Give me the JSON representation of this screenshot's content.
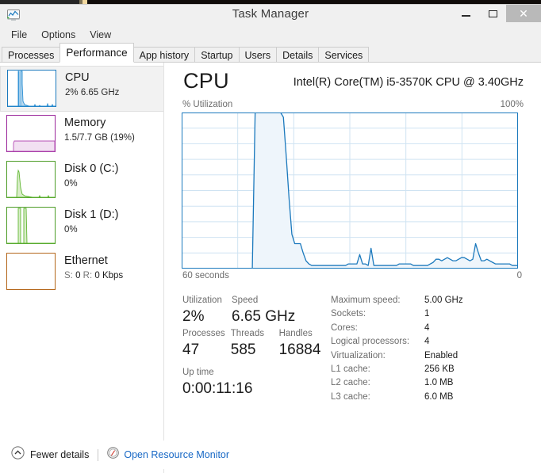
{
  "window": {
    "title": "Task Manager",
    "app_icon": "task-manager-icon",
    "controls": {
      "minimize": "–",
      "maximize": "☐",
      "close": "✕"
    }
  },
  "menubar": {
    "items": [
      {
        "label": "File"
      },
      {
        "label": "Options"
      },
      {
        "label": "View"
      }
    ]
  },
  "tabs": [
    {
      "label": "Processes",
      "active": false
    },
    {
      "label": "Performance",
      "active": true
    },
    {
      "label": "App history",
      "active": false
    },
    {
      "label": "Startup",
      "active": false
    },
    {
      "label": "Users",
      "active": false
    },
    {
      "label": "Details",
      "active": false
    },
    {
      "label": "Services",
      "active": false
    }
  ],
  "sidebar": {
    "items": [
      {
        "name": "CPU",
        "title": "CPU",
        "subtitle": "2%  6.65 GHz",
        "selected": true,
        "color": "#1b79bd",
        "fill": "#bcd9ee"
      },
      {
        "name": "Memory",
        "title": "Memory",
        "subtitle": "1.5/7.7 GB (19%)",
        "selected": false,
        "color": "#9b279b",
        "fill": "#f2e0f2"
      },
      {
        "name": "Disk 0 (C:)",
        "title": "Disk 0 (C:)",
        "subtitle": "0%",
        "selected": false,
        "color": "#4d9c27",
        "fill": "#d9edc9"
      },
      {
        "name": "Disk 1 (D:)",
        "title": "Disk 1 (D:)",
        "subtitle": "0%",
        "selected": false,
        "color": "#4d9c27",
        "fill": "#d9edc9"
      },
      {
        "name": "Ethernet",
        "title": "Ethernet",
        "subtitle_prefix_s": "S: ",
        "subtitle_val_s": "0",
        "subtitle_prefix_r": " R: ",
        "subtitle_val_r": "0 Kbps",
        "subtitle": "S: 0 R: 0 Kbps",
        "selected": false,
        "color": "#b4661a",
        "fill": "#f5e3d0"
      }
    ]
  },
  "main": {
    "heading": "CPU",
    "model": "Intel(R) Core(TM) i5-3570K CPU @ 3.40GHz",
    "axis": {
      "y_label": "% Utilization",
      "y_max": "100%",
      "x_left": "60 seconds",
      "x_right": "0"
    },
    "stats": {
      "utilization_label": "Utilization",
      "utilization_value": "2%",
      "speed_label": "Speed",
      "speed_value": "6.65 GHz",
      "processes_label": "Processes",
      "processes_value": "47",
      "threads_label": "Threads",
      "threads_value": "585",
      "handles_label": "Handles",
      "handles_value": "16884",
      "uptime_label": "Up time",
      "uptime_value": "0:00:11:16"
    },
    "specs": [
      {
        "label": "Maximum speed:",
        "value": "5.00 GHz"
      },
      {
        "label": "Sockets:",
        "value": "1"
      },
      {
        "label": "Cores:",
        "value": "4"
      },
      {
        "label": "Logical processors:",
        "value": "4"
      },
      {
        "label": "Virtualization:",
        "value": "Enabled"
      },
      {
        "label": "L1 cache:",
        "value": "256 KB"
      },
      {
        "label": "L2 cache:",
        "value": "1.0 MB"
      },
      {
        "label": "L3 cache:",
        "value": "6.0 MB"
      }
    ]
  },
  "statusbar": {
    "fewer_details_label": "Fewer details",
    "fewer_details_icon": "chevron-up-circle-icon",
    "resource_monitor_label": "Open Resource Monitor",
    "resource_monitor_icon": "resource-monitor-icon"
  },
  "colors": {
    "cpu_line": "#1b79bd",
    "cpu_fill": "#eef5fb",
    "grid": "#cfe3f2",
    "link": "#1667c5",
    "title_text": "#3b3b3b",
    "label_muted": "#6d6d6d"
  },
  "chart_data": {
    "type": "area",
    "title": "% Utilization",
    "xlabel": "60 seconds",
    "ylabel": "% Utilization",
    "ylim": [
      0,
      100
    ],
    "xlim": [
      60,
      0
    ],
    "grid": true,
    "legend": null,
    "series": [
      {
        "name": "CPU Utilization",
        "color": "#1b79bd",
        "values": [
          0,
          0,
          0,
          0,
          0,
          0,
          0,
          0,
          0,
          0,
          0,
          0,
          0,
          0,
          0,
          0,
          0,
          0,
          0,
          0,
          0,
          0,
          0,
          0,
          0,
          0,
          100,
          100,
          100,
          100,
          100,
          100,
          100,
          100,
          100,
          100,
          97,
          72,
          45,
          22,
          16,
          16,
          16,
          10,
          5,
          3,
          2,
          2,
          2,
          2,
          2,
          2,
          2,
          2,
          2,
          2,
          2,
          2,
          2,
          3,
          3,
          3,
          3,
          9,
          3,
          3,
          2,
          13,
          2,
          2,
          2,
          2,
          2,
          2,
          2,
          2,
          2,
          3,
          3,
          3,
          3,
          3,
          2,
          2,
          2,
          2,
          2,
          2,
          3,
          4,
          6,
          6,
          5,
          6,
          7,
          6,
          5,
          5,
          6,
          7,
          7,
          6,
          5,
          6,
          16,
          10,
          5,
          5,
          6,
          5,
          4,
          3,
          3,
          3,
          3,
          3,
          3,
          2,
          2,
          2
        ]
      }
    ]
  }
}
